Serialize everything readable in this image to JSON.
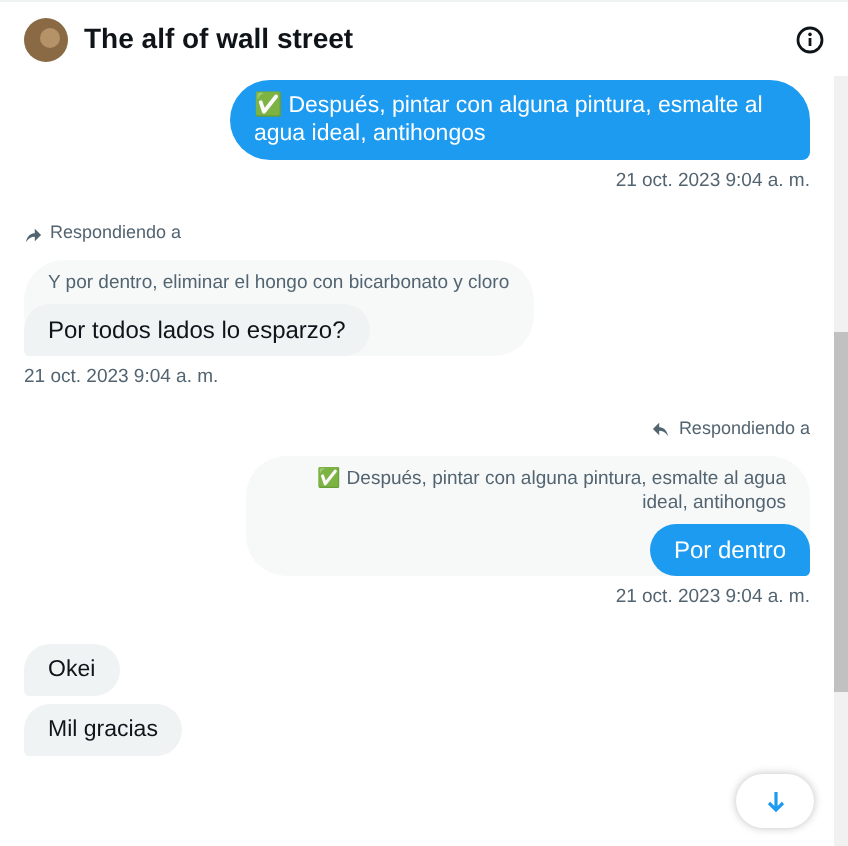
{
  "header": {
    "name": "The alf of wall street"
  },
  "messages": [
    {
      "kind": "sent",
      "bubbles": [
        "✅ Después, pintar con alguna pintura, esmalte al agua ideal, antihongos"
      ],
      "timestamp": "21 oct. 2023 9:04 a. m."
    },
    {
      "kind": "received",
      "reply": {
        "label": "Respondiendo a",
        "text": "Y por dentro, eliminar el hongo con bicarbonato y cloro"
      },
      "bubbles": [
        "Por todos lados lo esparzo?"
      ],
      "timestamp": "21 oct. 2023 9:04 a. m."
    },
    {
      "kind": "sent",
      "reply": {
        "label": "Respondiendo a",
        "text": "✅ Después, pintar con alguna pintura, esmalte al agua ideal, antihongos"
      },
      "bubbles": [
        "Por dentro"
      ],
      "timestamp": "21 oct. 2023 9:04 a. m."
    },
    {
      "kind": "received",
      "bubbles": [
        "Okei",
        "Mil gracias"
      ]
    }
  ]
}
